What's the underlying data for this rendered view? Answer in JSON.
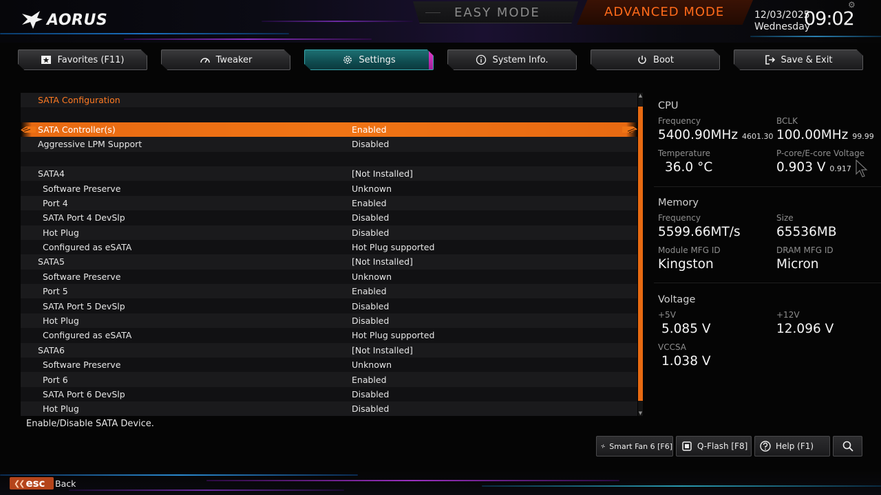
{
  "brand": {
    "logo_text": "AORUS"
  },
  "modes": {
    "easy": "EASY MODE",
    "advanced": "ADVANCED MODE"
  },
  "datetime": {
    "date": "12/03/2025",
    "day": "Wednesday",
    "time": "09:02"
  },
  "tabs": [
    {
      "label": "Favorites (F11)",
      "icon": "star-icon"
    },
    {
      "label": "Tweaker",
      "icon": "gauge-icon"
    },
    {
      "label": "Settings",
      "icon": "gear-icon",
      "active": true
    },
    {
      "label": "System Info.",
      "icon": "info-icon"
    },
    {
      "label": "Boot",
      "icon": "power-icon"
    },
    {
      "label": "Save & Exit",
      "icon": "exit-icon"
    }
  ],
  "main": {
    "rows": [
      {
        "name": "SATA Configuration",
        "value": ""
      },
      {
        "name": "",
        "value": ""
      },
      {
        "name": "SATA Controller(s)",
        "value": "Enabled"
      },
      {
        "name": "Aggressive LPM Support",
        "value": "Disabled"
      },
      {
        "name": "",
        "value": ""
      },
      {
        "name": "SATA4",
        "value": "[Not Installed]"
      },
      {
        "name": "Software Preserve",
        "value": "Unknown"
      },
      {
        "name": "Port 4",
        "value": "Enabled"
      },
      {
        "name": "SATA Port 4 DevSlp",
        "value": "Disabled"
      },
      {
        "name": "Hot Plug",
        "value": "Disabled"
      },
      {
        "name": "Configured as eSATA",
        "value": "Hot Plug supported"
      },
      {
        "name": "SATA5",
        "value": "[Not Installed]"
      },
      {
        "name": "Software Preserve",
        "value": "Unknown"
      },
      {
        "name": "Port 5",
        "value": "Enabled"
      },
      {
        "name": "SATA Port 5 DevSlp",
        "value": "Disabled"
      },
      {
        "name": "Hot Plug",
        "value": "Disabled"
      },
      {
        "name": "Configured as eSATA",
        "value": "Hot Plug supported"
      },
      {
        "name": "SATA6",
        "value": "[Not Installed]"
      },
      {
        "name": "Software Preserve",
        "value": "Unknown"
      },
      {
        "name": "Port 6",
        "value": "Enabled"
      },
      {
        "name": "SATA Port 6 DevSlp",
        "value": "Disabled"
      },
      {
        "name": "Hot Plug",
        "value": "Disabled"
      }
    ],
    "help_text": "Enable/Disable SATA Device."
  },
  "cpu": {
    "title": "CPU",
    "freq_label": "Frequency",
    "freq_value": "5400.90MHz",
    "freq_sub": "4601.30",
    "bclk_label": "BCLK",
    "bclk_value": "100.00MHz",
    "bclk_sub": "99.99",
    "temp_label": "Temperature",
    "temp_value": "36.0 °C",
    "volt_label": "P-core/E-core Voltage",
    "volt_value": "0.903 V",
    "volt_sub": "0.917"
  },
  "memory": {
    "title": "Memory",
    "freq_label": "Frequency",
    "freq_value": "5599.66MT/s",
    "size_label": "Size",
    "size_value": "65536MB",
    "module_label": "Module MFG ID",
    "module_value": "Kingston",
    "dram_label": "DRAM MFG ID",
    "dram_value": "Micron"
  },
  "voltage": {
    "title": "Voltage",
    "v5_label": "+5V",
    "v5_value": "5.085 V",
    "v12_label": "+12V",
    "v12_value": "12.096 V",
    "vccsa_label": "VCCSA",
    "vccsa_value": "1.038 V"
  },
  "bottom_buttons": {
    "smartfan": "Smart Fan 6 [F6]",
    "qflash": "Q-Flash [F8]",
    "help": "Help (F1)"
  },
  "footer": {
    "esc": "esc",
    "back": "Back"
  },
  "colors": {
    "accent": "#f07415",
    "active_tab": "#0f4c50",
    "section_text": "#ff7a22"
  }
}
